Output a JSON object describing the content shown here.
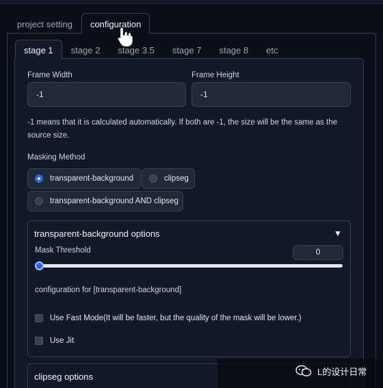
{
  "outer_tabs": [
    {
      "label": "project setting",
      "active": false
    },
    {
      "label": "configuration",
      "active": true
    }
  ],
  "inner_tabs": [
    {
      "label": "stage 1",
      "active": true
    },
    {
      "label": "stage 2",
      "active": false
    },
    {
      "label": "stage 3.5",
      "active": false
    },
    {
      "label": "stage 7",
      "active": false
    },
    {
      "label": "stage 8",
      "active": false
    },
    {
      "label": "etc",
      "active": false
    }
  ],
  "frame_width": {
    "label": "Frame Width",
    "value": "-1"
  },
  "frame_height": {
    "label": "Frame Height",
    "value": "-1"
  },
  "size_note": "-1 means that it is calculated automatically. If both are -1, the size will be the same as the source size.",
  "masking": {
    "label": "Masking Method",
    "options": [
      "transparent-background",
      "clipseg",
      "transparent-background AND clipseg"
    ],
    "selected": "transparent-background"
  },
  "tb_options": {
    "title": "transparent-background options",
    "mask_threshold": {
      "label": "Mask Threshold",
      "value": "0"
    },
    "config_label": "configuration for [transparent-background]",
    "fast_mode": {
      "label": "Use Fast Mode(It will be faster, but the quality of the mask will be lower.)",
      "checked": false
    },
    "use_jit": {
      "label": "Use Jit",
      "checked": false
    }
  },
  "clipseg_options": {
    "title": "clipseg options"
  },
  "watermark": {
    "text": "L的设计日常"
  },
  "colors": {
    "accent": "#2563eb",
    "background": "#0b0f19",
    "panel": "#111827",
    "input": "#1f2937",
    "border": "#374151"
  }
}
